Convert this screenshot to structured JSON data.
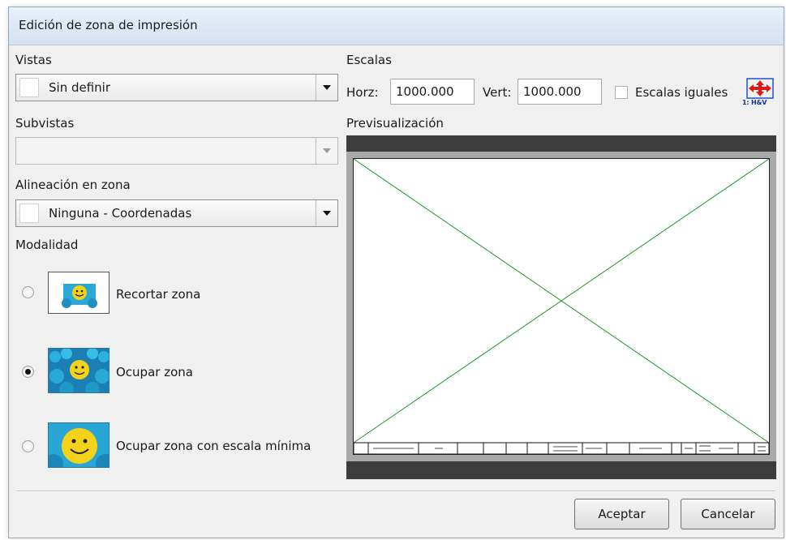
{
  "window": {
    "title": "Edición de zona de impresión"
  },
  "vistas": {
    "label": "Vistas",
    "value": "Sin definir"
  },
  "subvistas": {
    "label": "Subvistas",
    "value": ""
  },
  "alineacion": {
    "label": "Alineación en zona",
    "value": "Ninguna - Coordenadas"
  },
  "modalidad": {
    "label": "Modalidad",
    "options": [
      {
        "label": "Recortar zona",
        "checked": false
      },
      {
        "label": "Ocupar zona",
        "checked": true
      },
      {
        "label": "Ocupar zona con escala mínima",
        "checked": false
      }
    ]
  },
  "escalas": {
    "label": "Escalas",
    "horz_label": "Horz:",
    "horz_value": "1000.000",
    "vert_label": "Vert:",
    "vert_value": "1000.000",
    "equal_label": "Escalas iguales",
    "equal_checked": false,
    "icon_caption": "1: H&V"
  },
  "preview": {
    "label": "Previsualización",
    "line_color": "#1e9a2a"
  },
  "buttons": {
    "accept": "Aceptar",
    "cancel": "Cancelar"
  }
}
